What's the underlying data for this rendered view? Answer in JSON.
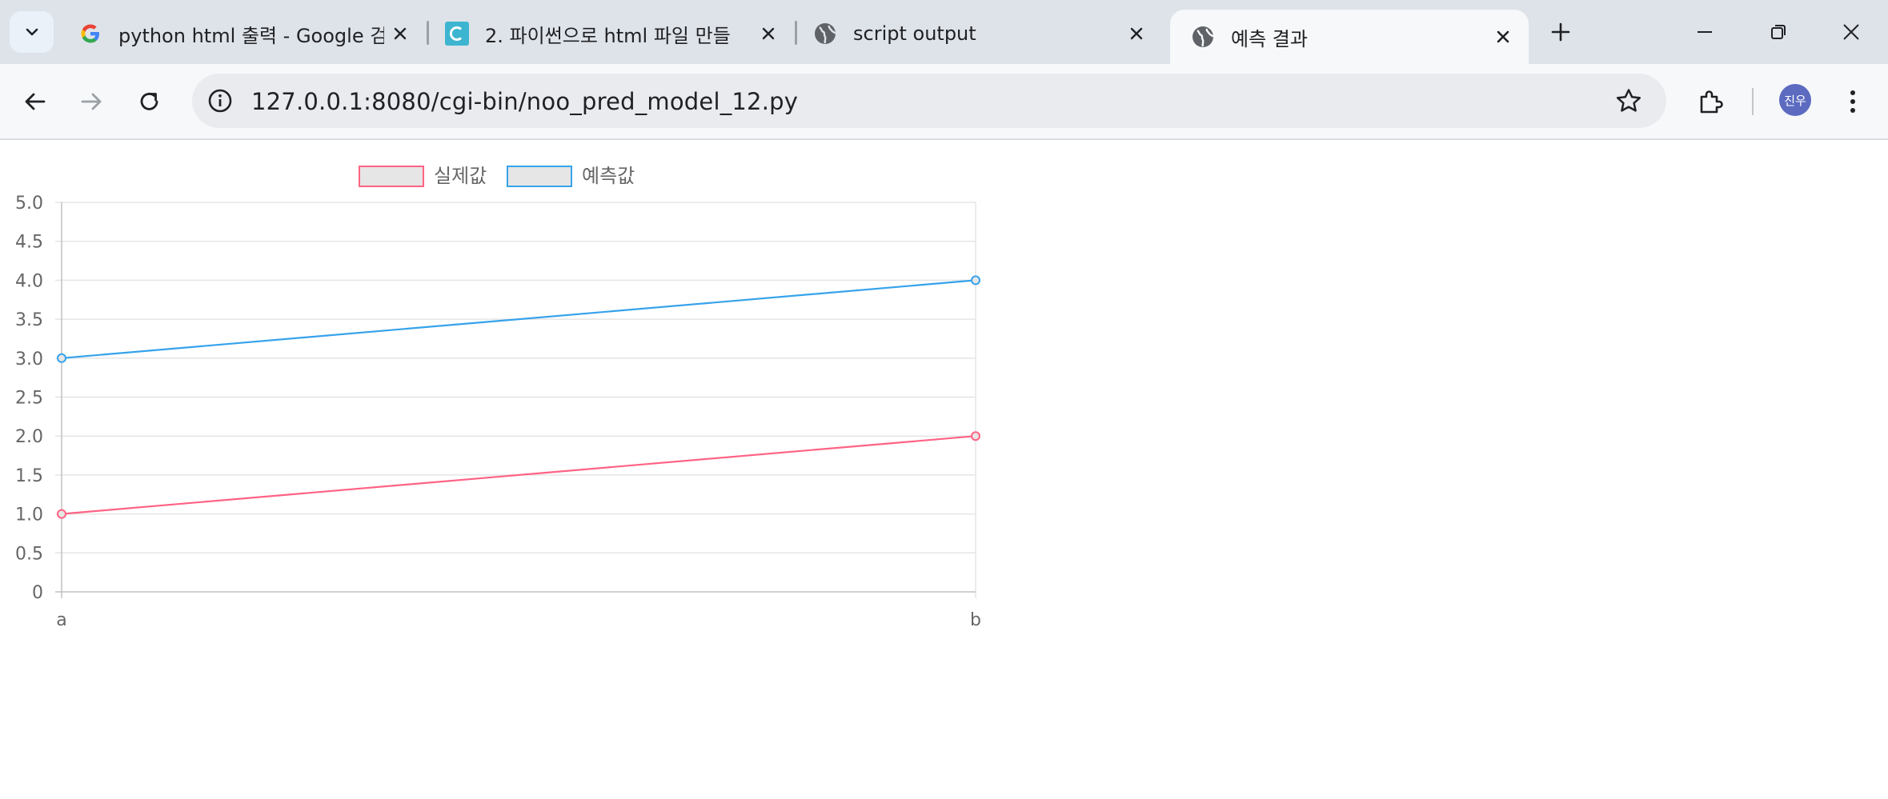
{
  "browser": {
    "tabs": [
      {
        "title": "python html 출력 - Google 검",
        "favicon": "google-g-icon",
        "active": false
      },
      {
        "title": "2. 파이썬으로 html 파일 만들",
        "favicon": "c-site-icon",
        "active": false
      },
      {
        "title": "script output",
        "favicon": "globe-icon",
        "active": false
      },
      {
        "title": "예측 결과",
        "favicon": "globe-icon",
        "active": true
      }
    ],
    "url": "127.0.0.1:8080/cgi-bin/noo_pred_model_12.py",
    "profile_initials": "진우"
  },
  "colors": {
    "actual": "#ff6384",
    "predicted": "#36a2eb",
    "legend_fill": "#e6e6e6",
    "grid": "#e5e5e5",
    "tick_text": "#666666"
  },
  "chart_data": {
    "type": "line",
    "categories": [
      "a",
      "b"
    ],
    "series": [
      {
        "name": "실제값",
        "values": [
          1,
          2
        ],
        "color": "#ff6384"
      },
      {
        "name": "예측값",
        "values": [
          3,
          4
        ],
        "color": "#36a2eb"
      }
    ],
    "ylim": [
      0,
      5.0
    ],
    "yticks": [
      "0",
      "0.5",
      "1.0",
      "1.5",
      "2.0",
      "2.5",
      "3.0",
      "3.5",
      "4.0",
      "4.5",
      "5.0"
    ],
    "grid": true,
    "legend_position": "top"
  }
}
